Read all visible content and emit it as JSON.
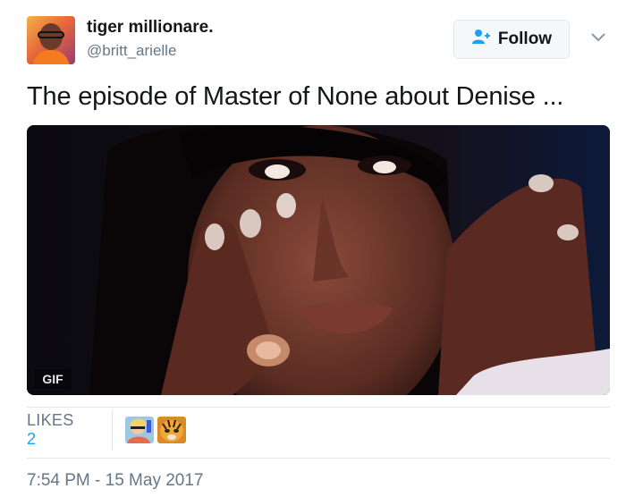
{
  "header": {
    "display_name": "tiger millionare.",
    "handle": "@britt_arielle",
    "follow_label": "Follow",
    "follow_icon": "add-user-icon",
    "menu_icon": "chevron-down-icon"
  },
  "tweet": {
    "text": "The episode of Master of None about Denise ...",
    "media_badge": "GIF"
  },
  "stats": {
    "likes_label": "LIKES",
    "likes_count": "2",
    "likers": [
      "liker-avatar-1",
      "liker-avatar-2"
    ]
  },
  "timestamp": "7:54 PM - 15 May 2017",
  "colors": {
    "accent": "#1da1f2",
    "text": "#14171a",
    "muted": "#657786",
    "border": "#e1e8ed"
  }
}
